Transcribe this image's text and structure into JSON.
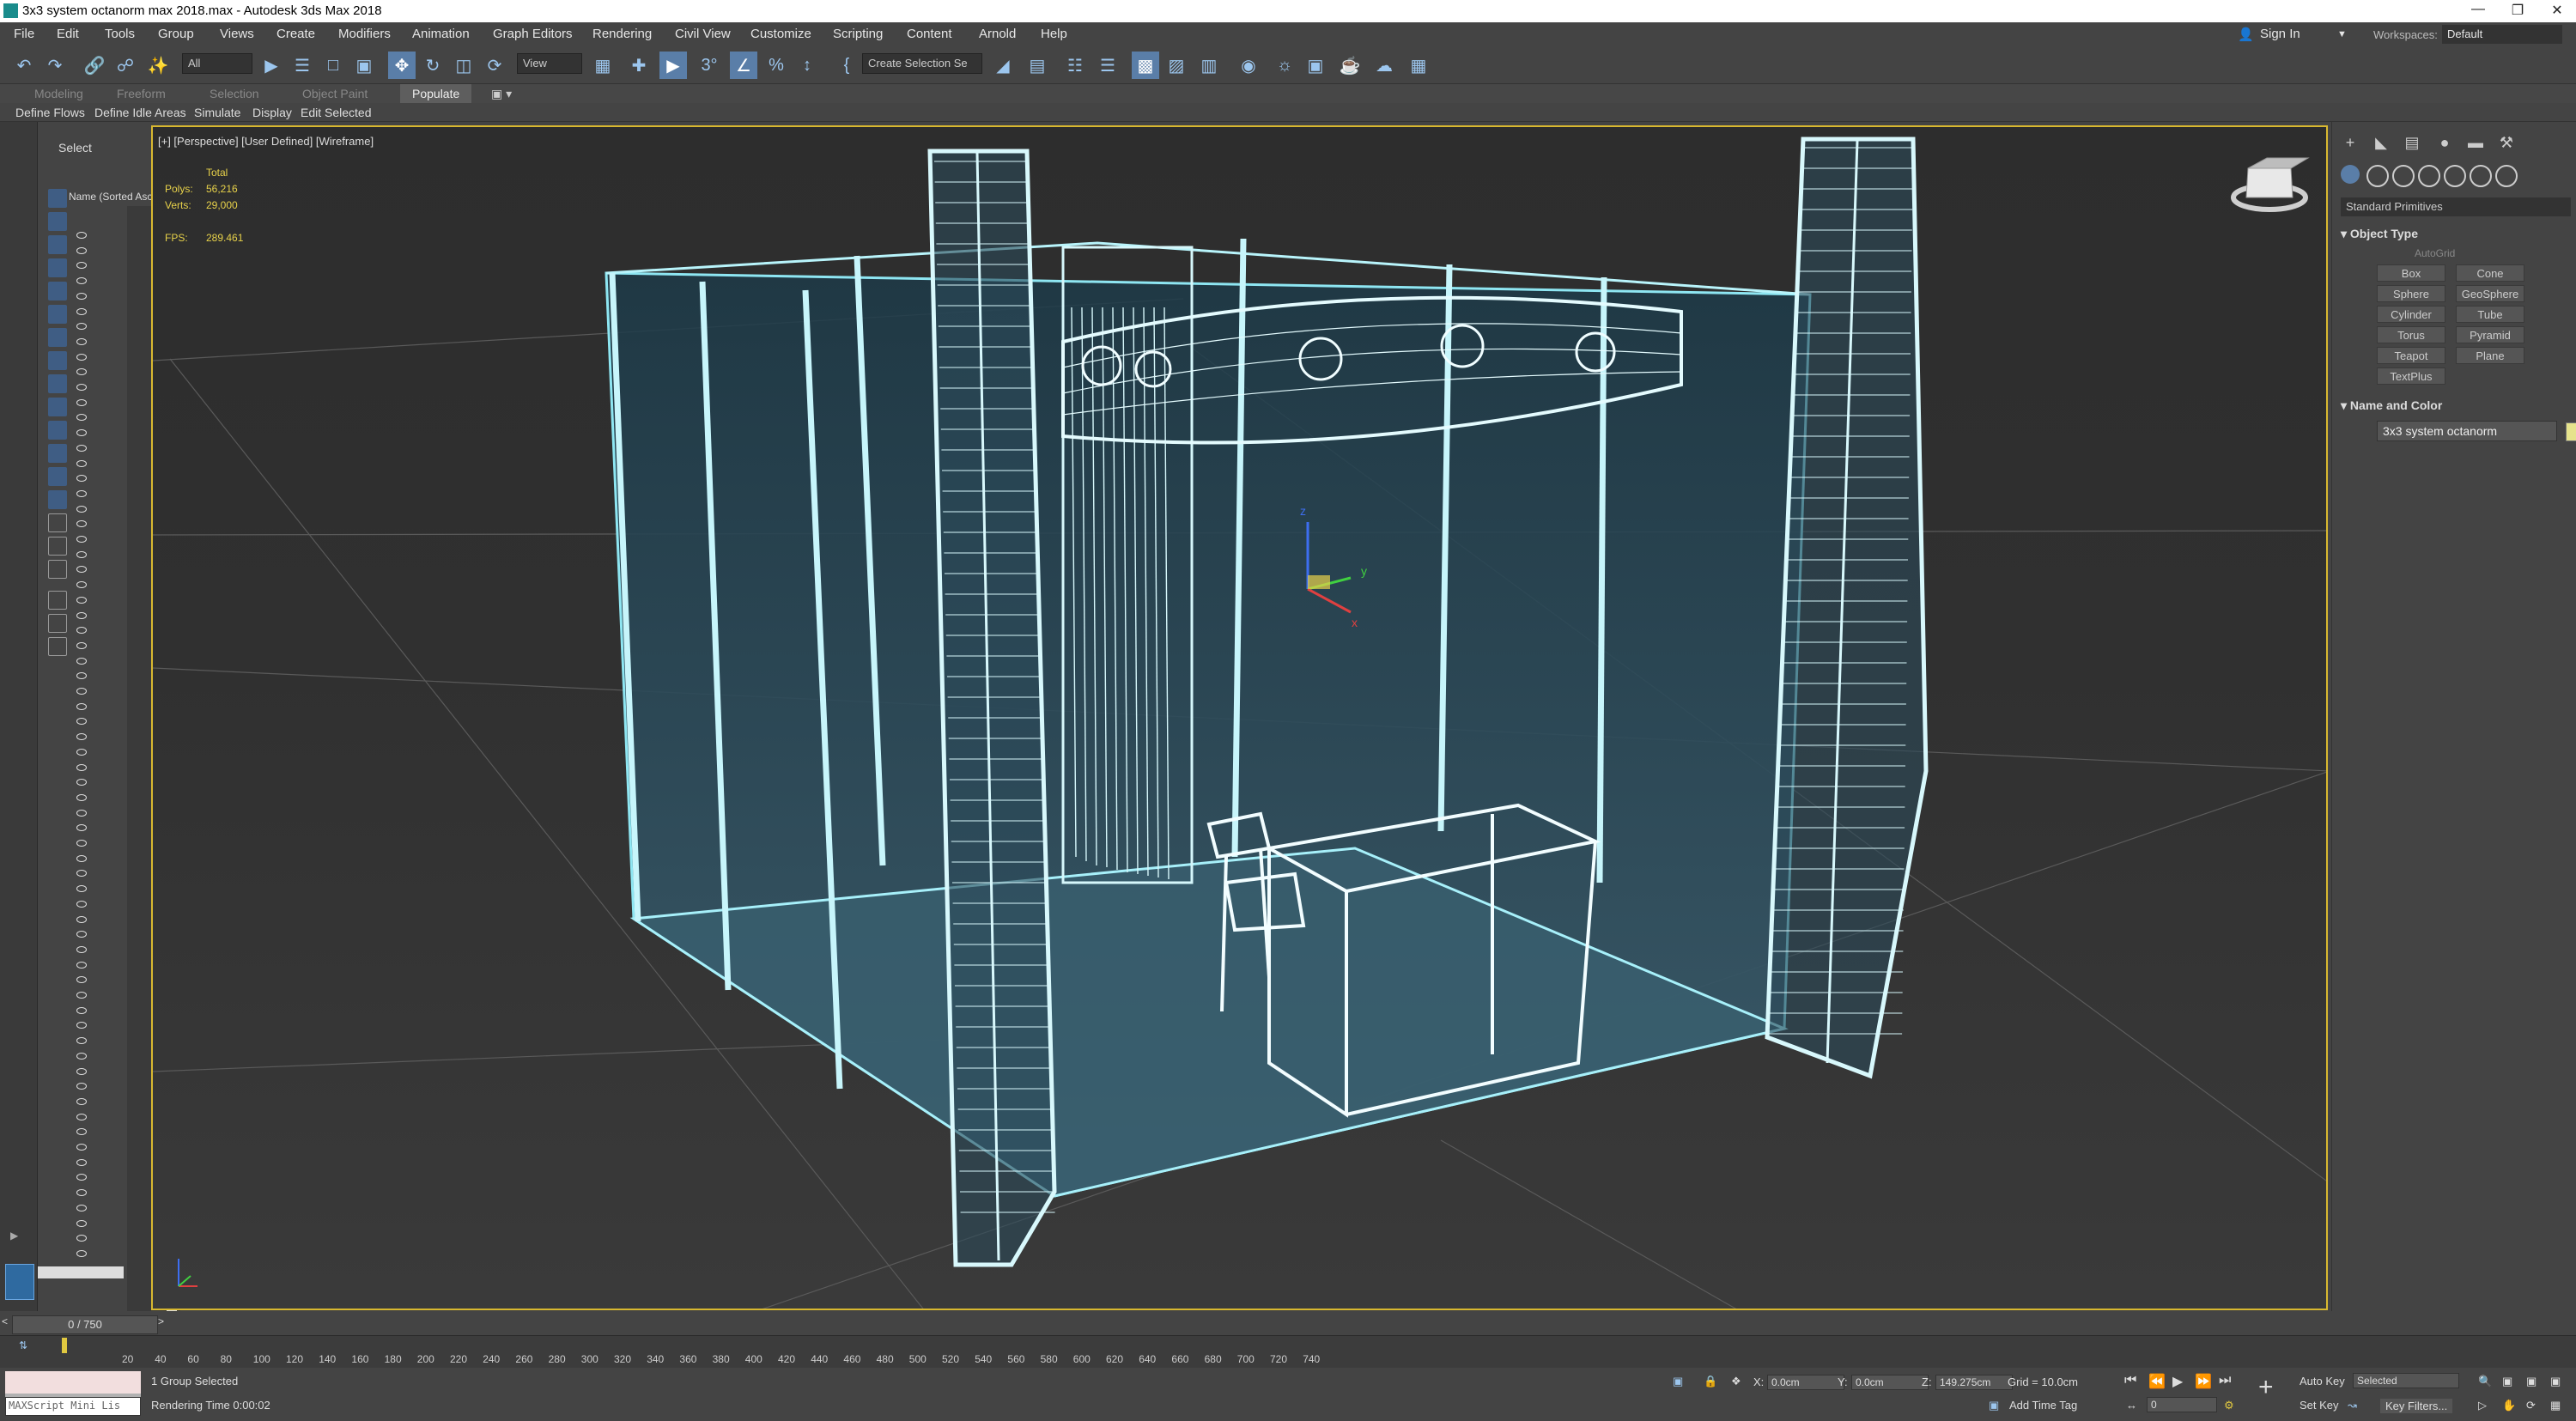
{
  "window": {
    "title": "3x3 system octanorm max 2018.max - Autodesk 3ds Max 2018",
    "controls": [
      "—",
      "❐",
      "✕"
    ]
  },
  "menu": [
    "File",
    "Edit",
    "Tools",
    "Group",
    "Views",
    "Create",
    "Modifiers",
    "Animation",
    "Graph Editors",
    "Rendering",
    "Civil View",
    "Customize",
    "Scripting",
    "Content",
    "Arnold",
    "Help"
  ],
  "account": {
    "sign_in": "Sign In",
    "workspaces_label": "Workspaces:",
    "workspace": "Default"
  },
  "toolbar": {
    "selection_filter": "All",
    "ref_coord": "View",
    "selection_set": "Create Selection Se"
  },
  "ribbon": {
    "tabs": [
      "Modeling",
      "Freeform",
      "Selection",
      "Object Paint",
      "Populate"
    ],
    "selected_tab": "Populate",
    "subtools": [
      "Define Flows",
      "Define Idle Areas",
      "Simulate",
      "Display",
      "Edit Selected"
    ]
  },
  "explorer": {
    "title": "Select",
    "column_header": "Name (Sorted Ascending)"
  },
  "viewport": {
    "label": "[+] [Perspective] [User Defined] [Wireframe]",
    "stats": {
      "total_label": "Total",
      "polys_label": "Polys:",
      "polys": "56,216",
      "verts_label": "Verts:",
      "verts": "29,000",
      "fps_label": "FPS:",
      "fps": "289.461"
    },
    "gizmo_x": "x",
    "gizmo_y": "y",
    "gizmo_z": "z"
  },
  "command_panel": {
    "dropdown": "Standard Primitives",
    "object_type_title": "Object Type",
    "autogrid": "AutoGrid",
    "primitives": [
      "Box",
      "Cone",
      "Sphere",
      "GeoSphere",
      "Cylinder",
      "Tube",
      "Torus",
      "Pyramid",
      "Teapot",
      "Plane",
      "TextPlus"
    ],
    "name_color_title": "Name and Color",
    "object_name": "3x3 system octanorm",
    "object_color": "#e6e38c"
  },
  "timeline": {
    "frame": "0 / 750",
    "ticks": [
      "20",
      "40",
      "60",
      "80",
      "100",
      "120",
      "140",
      "160",
      "180",
      "200",
      "220",
      "240",
      "260",
      "280",
      "300",
      "320",
      "340",
      "360",
      "380",
      "400",
      "420",
      "440",
      "460",
      "480",
      "500",
      "520",
      "540",
      "560",
      "580",
      "600",
      "620",
      "640",
      "660",
      "680",
      "700",
      "720",
      "740"
    ]
  },
  "status": {
    "maxscript": "MAXScript Mini Lis",
    "selected": "1 Group Selected",
    "render_time": "Rendering Time  0:00:02",
    "x_label": "X:",
    "x": "0.0cm",
    "y_label": "Y:",
    "y": "0.0cm",
    "z_label": "Z:",
    "z": "149.275cm",
    "grid": "Grid = 10.0cm",
    "add_time_tag": "Add Time Tag",
    "auto_key": "Auto Key",
    "set_key": "Set Key",
    "key_mode": "Selected",
    "key_filters": "Key Filters...",
    "current_frame": "0"
  }
}
